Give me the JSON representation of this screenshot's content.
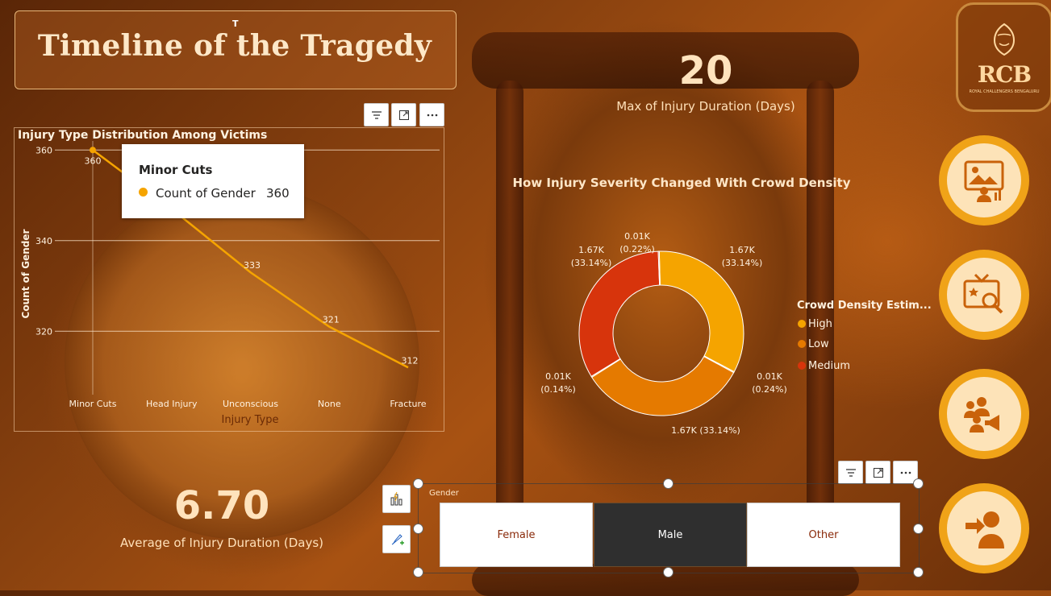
{
  "title": {
    "text": "Timeline of the Tragedy",
    "marker": "T"
  },
  "logo": {
    "text": "RCB",
    "subtext": "ROYAL CHALLENGERS BENGALURU"
  },
  "kpi_max": {
    "value": "20",
    "label": "Max of Injury Duration (Days)"
  },
  "kpi_avg": {
    "value": "6.70",
    "label": "Average of Injury Duration (Days)"
  },
  "tooltip": {
    "title": "Minor Cuts",
    "label": "Count of Gender",
    "value": "360"
  },
  "donut": {
    "title": "How Injury Severity Changed With Crowd Density",
    "legend_title": "Crowd Density Estim...",
    "labels": {
      "top_left": [
        "1.67K",
        "(33.14%)"
      ],
      "top_mid": [
        "0.01K",
        "(0.22%)"
      ],
      "top_right": [
        "1.67K",
        "(33.14%)"
      ],
      "left": [
        "0.01K",
        "(0.14%)"
      ],
      "right": [
        "0.01K",
        "(0.24%)"
      ],
      "bottom": [
        "1.67K (33.14%)"
      ]
    }
  },
  "slicer": {
    "label": "Gender",
    "options": [
      "Female",
      "Male",
      "Other"
    ],
    "selected": "Male"
  },
  "nav": [
    "image-gallery-icon",
    "tv-search-icon",
    "audience-megaphone-icon",
    "user-exit-icon"
  ],
  "colors": {
    "high": "#f5a400",
    "low": "#e57a00",
    "medium": "#d7340c",
    "line": "#f5a400"
  },
  "chart_data": [
    {
      "type": "line",
      "title": "Injury Type Distribution Among Victims",
      "xlabel": "Injury Type",
      "ylabel": "Count of Gender",
      "categories": [
        "Minor Cuts",
        "Head Injury",
        "Unconscious",
        "None",
        "Fracture"
      ],
      "series": [
        {
          "name": "Count of Gender",
          "values": [
            360,
            347,
            333,
            321,
            312
          ]
        }
      ],
      "data_labels": [
        "360",
        null,
        "333",
        "321",
        "312"
      ],
      "yticks": [
        320,
        340,
        360
      ],
      "ylim": [
        306,
        362
      ],
      "grid": true
    },
    {
      "type": "pie",
      "title": "How Injury Severity Changed With Crowd Density",
      "legend": [
        "High",
        "Low",
        "Medium"
      ],
      "slices": [
        {
          "category": "High",
          "value": 1670,
          "percent": 33.14
        },
        {
          "category": "High",
          "value": 10,
          "percent": 0.24
        },
        {
          "category": "Low",
          "value": 1670,
          "percent": 33.14
        },
        {
          "category": "Low",
          "value": 10,
          "percent": 0.14
        },
        {
          "category": "Medium",
          "value": 1670,
          "percent": 33.14
        },
        {
          "category": "Medium",
          "value": 10,
          "percent": 0.22
        }
      ]
    }
  ]
}
